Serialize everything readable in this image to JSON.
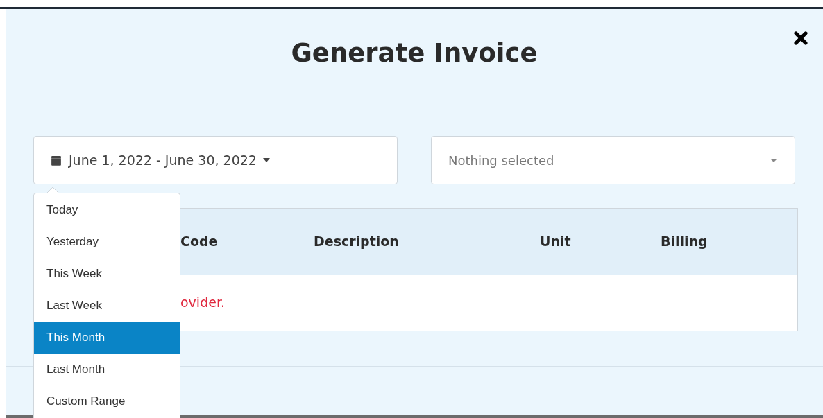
{
  "modal": {
    "title": "Generate Invoice"
  },
  "date_range": {
    "value": "June 1, 2022 - June 30, 2022",
    "expanded": true
  },
  "provider_select": {
    "placeholder": "Nothing selected"
  },
  "range_menu": [
    {
      "label": "Today",
      "selected": false
    },
    {
      "label": "Yesterday",
      "selected": false
    },
    {
      "label": "This Week",
      "selected": false
    },
    {
      "label": "Last Week",
      "selected": false
    },
    {
      "label": "This Month",
      "selected": true
    },
    {
      "label": "Last Month",
      "selected": false
    },
    {
      "label": "Custom Range",
      "selected": false
    }
  ],
  "table": {
    "columns": [
      "Code",
      "Description",
      "Unit",
      "Billing"
    ],
    "message": "ovider."
  }
}
